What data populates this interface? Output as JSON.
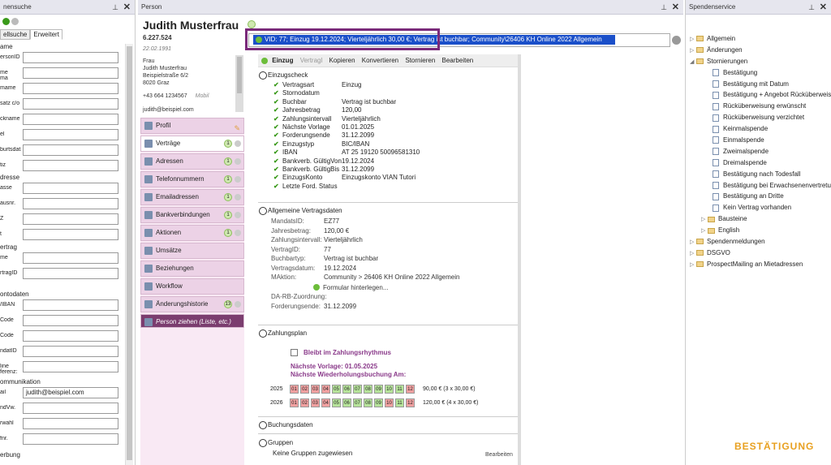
{
  "left_panel": {
    "title": "nensuche",
    "tabs": [
      "ellsuche",
      "Erweitert"
    ],
    "sections": [
      {
        "title": "ame",
        "fields": [
          {
            "label": "ersonID",
            "value": ""
          },
          {
            "label": "me\nma",
            "value": ""
          },
          {
            "label": "mame",
            "value": ""
          },
          {
            "label": "satz c/o",
            "value": ""
          },
          {
            "label": "ckname",
            "value": ""
          },
          {
            "label": "el",
            "value": ""
          },
          {
            "label": "burtsdat.",
            "value": ""
          },
          {
            "label": "tiz",
            "value": ""
          }
        ]
      },
      {
        "title": "dresse",
        "fields": [
          {
            "label": "asse",
            "value": ""
          },
          {
            "label": "ausnr.",
            "value": ""
          },
          {
            "label": "Z",
            "value": ""
          },
          {
            "label": "t",
            "value": ""
          }
        ]
      },
      {
        "title": "ertrag",
        "fields": [
          {
            "label": "me",
            "value": ""
          },
          {
            "label": "rtragID",
            "value": ""
          }
        ]
      },
      {
        "title": "ontodaten",
        "fields": [
          {
            "label": "/IBAN",
            "value": ""
          },
          {
            "label": "Code",
            "value": ""
          },
          {
            "label": "Code",
            "value": ""
          },
          {
            "label": "ndatID",
            "value": ""
          },
          {
            "label": "line\nferenz:",
            "value": ""
          }
        ]
      },
      {
        "title": "ommunikation",
        "fields": [
          {
            "label": "ail",
            "value": "judith@beispiel.com"
          },
          {
            "label": "ndVw.",
            "value": ""
          },
          {
            "label": "rwahl",
            "value": ""
          },
          {
            "label": "fnr.",
            "value": ""
          }
        ]
      },
      {
        "title": "erbung",
        "fields": []
      }
    ]
  },
  "person": {
    "header": "Person",
    "name": "Judith Musterfrau",
    "id": "6.227.524",
    "dob": "22.02.1991",
    "address": [
      "Frau",
      "Judith Musterfrau",
      "Beispielstraße 6/2",
      "8020 Graz"
    ],
    "phone": "+43 664 1234567",
    "phone_type": "Mobil",
    "email": "judith@beispiel.com",
    "nav": [
      {
        "label": "Profil",
        "count": ""
      },
      {
        "label": "Verträge",
        "count": "1"
      },
      {
        "label": "Adressen",
        "count": "1"
      },
      {
        "label": "Telefonnummern",
        "count": "1"
      },
      {
        "label": "Emailadressen",
        "count": "1"
      },
      {
        "label": "Bankverbindungen",
        "count": "1"
      },
      {
        "label": "Aktionen",
        "count": "1"
      },
      {
        "label": "Umsätze",
        "count": ""
      },
      {
        "label": "Beziehungen",
        "count": ""
      },
      {
        "label": "Workflow",
        "count": ""
      },
      {
        "label": "Änderungshistorie",
        "count": "13"
      },
      {
        "label": "Person ziehen (Liste, etc.)",
        "count": ""
      }
    ],
    "vid_text": "VID: 77; Einzug 19.12.2024; Vierteljährlich 30,00 €; Vertrag ist buchbar; Community\\26406 KH Online 2022 Allgemein",
    "toolbar": [
      "Einzug",
      "Vertragl",
      "Kopieren",
      "Konvertieren",
      "Stornieren",
      "Bearbeiten"
    ],
    "einzugscheck": {
      "title": "Einzugscheck",
      "rows": [
        [
          "Vertragsart",
          "Einzug"
        ],
        [
          "Stornodatum",
          ""
        ],
        [
          "Buchbar",
          "Vertrag ist buchbar"
        ],
        [
          "Jahresbetrag",
          "120,00"
        ],
        [
          "Zahlungsintervall",
          "Vierteljährlich"
        ],
        [
          "Nächste Vorlage",
          "01.01.2025"
        ],
        [
          "Forderungsende",
          "31.12.2099"
        ],
        [
          "Einzugstyp",
          "BIC/IBAN"
        ],
        [
          "IBAN",
          "AT 25 19120 50096581310"
        ],
        [
          "Bankverb. GültigVon",
          "19.12.2024"
        ],
        [
          "Bankverb. GültigBis",
          "31.12.2099"
        ],
        [
          "EinzugsKonto",
          "Einzugskonto VIAN Tutori"
        ],
        [
          "Letzte Ford. Status",
          ""
        ]
      ]
    },
    "allgemein": {
      "title": "Allgemeine Vertragsdaten",
      "rows": [
        [
          "MandatsID:",
          "EZ77"
        ],
        [
          "Jahresbetrag:",
          "120,00 €"
        ],
        [
          "Zahlungsintervall:",
          "Vierteljährlich"
        ],
        [
          "VertragID:",
          "77"
        ],
        [
          "Buchbartyp:",
          "Vertrag ist buchbar"
        ],
        [
          "Vertragsdatum:",
          "19.12.2024"
        ],
        [
          "MAktion:",
          "Community  >  26406 KH Online 2022 Allgemein"
        ]
      ],
      "formular": "Formular hinterlegen...",
      "da_rb": "DA-RB-Zuordnung:",
      "forderungsende_label": "Forderungsende:",
      "forderungsende": "31.12.2099"
    },
    "zahlungsplan": {
      "title": "Zahlungsplan",
      "checkbox": "Bleibt im Zahlungsrhythmus",
      "naechste_vorlage": "Nächste Vorlage: 01.05.2025",
      "naechste_wdh": "Nächste Wiederholungsbuchung Am:",
      "years": [
        {
          "year": "2025",
          "months": [
            "01",
            "02",
            "03",
            "04",
            "05",
            "06",
            "07",
            "08",
            "09",
            "10",
            "11",
            "12"
          ],
          "paid": [
            0,
            0,
            0,
            0,
            1,
            1,
            1,
            1,
            1,
            1,
            1,
            0
          ],
          "total": "90,00 € (3 x 30,00 €)"
        },
        {
          "year": "2026",
          "months": [
            "01",
            "02",
            "03",
            "04",
            "05",
            "06",
            "07",
            "08",
            "09",
            "10",
            "11",
            "12"
          ],
          "paid": [
            0,
            0,
            0,
            0,
            1,
            1,
            1,
            1,
            1,
            0,
            1,
            0
          ],
          "total": "120,00 € (4 x 30,00 €)"
        }
      ]
    },
    "buchungsdaten": "Buchungsdaten",
    "gruppen": {
      "title": "Gruppen",
      "empty": "Keine Gruppen zugewiesen",
      "edit": "Bearbeiten"
    }
  },
  "right_panel": {
    "title": "Spendenservice",
    "tree": [
      {
        "label": "Allgemein",
        "type": "folder",
        "level": 0,
        "arrow": "▷"
      },
      {
        "label": "Änderungen",
        "type": "folder",
        "level": 0,
        "arrow": "▷"
      },
      {
        "label": "Stornierungen",
        "type": "folder",
        "level": 0,
        "arrow": "◢"
      },
      {
        "label": "Bestätigung",
        "type": "doc",
        "level": 1
      },
      {
        "label": "Bestätigung mit Datum",
        "type": "doc",
        "level": 1
      },
      {
        "label": "Bestätigung + Angebot Rücküberweisu",
        "type": "doc",
        "level": 1
      },
      {
        "label": "Rücküberweisung erwünscht",
        "type": "doc",
        "level": 1
      },
      {
        "label": "Rücküberweisung verzichtet",
        "type": "doc",
        "level": 1
      },
      {
        "label": "Keinmalspende",
        "type": "doc",
        "level": 1
      },
      {
        "label": "Einmalspende",
        "type": "doc",
        "level": 1
      },
      {
        "label": "Zweimalspende",
        "type": "doc",
        "level": 1
      },
      {
        "label": "Dreimalspende",
        "type": "doc",
        "level": 1
      },
      {
        "label": "Bestätigung nach Todesfall",
        "type": "doc",
        "level": 1
      },
      {
        "label": "Bestätigung bei Erwachsenenvertretung",
        "type": "doc",
        "level": 1
      },
      {
        "label": "Bestätigung an Dritte",
        "type": "doc",
        "level": 1
      },
      {
        "label": "Kein Vertrag vorhanden",
        "type": "doc",
        "level": 1
      },
      {
        "label": "Bausteine",
        "type": "folder",
        "level": 1,
        "arrow": "▷"
      },
      {
        "label": "English",
        "type": "folder",
        "level": 1,
        "arrow": "▷"
      },
      {
        "label": "Spendenmeldungen",
        "type": "folder",
        "level": 0,
        "arrow": "▷"
      },
      {
        "label": "DSGVO",
        "type": "folder",
        "level": 0,
        "arrow": "▷"
      },
      {
        "label": "ProspectMailing an Mietadressen",
        "type": "folder",
        "level": 0,
        "arrow": "▷"
      }
    ]
  },
  "brand": "BESTÄTIGUNG"
}
